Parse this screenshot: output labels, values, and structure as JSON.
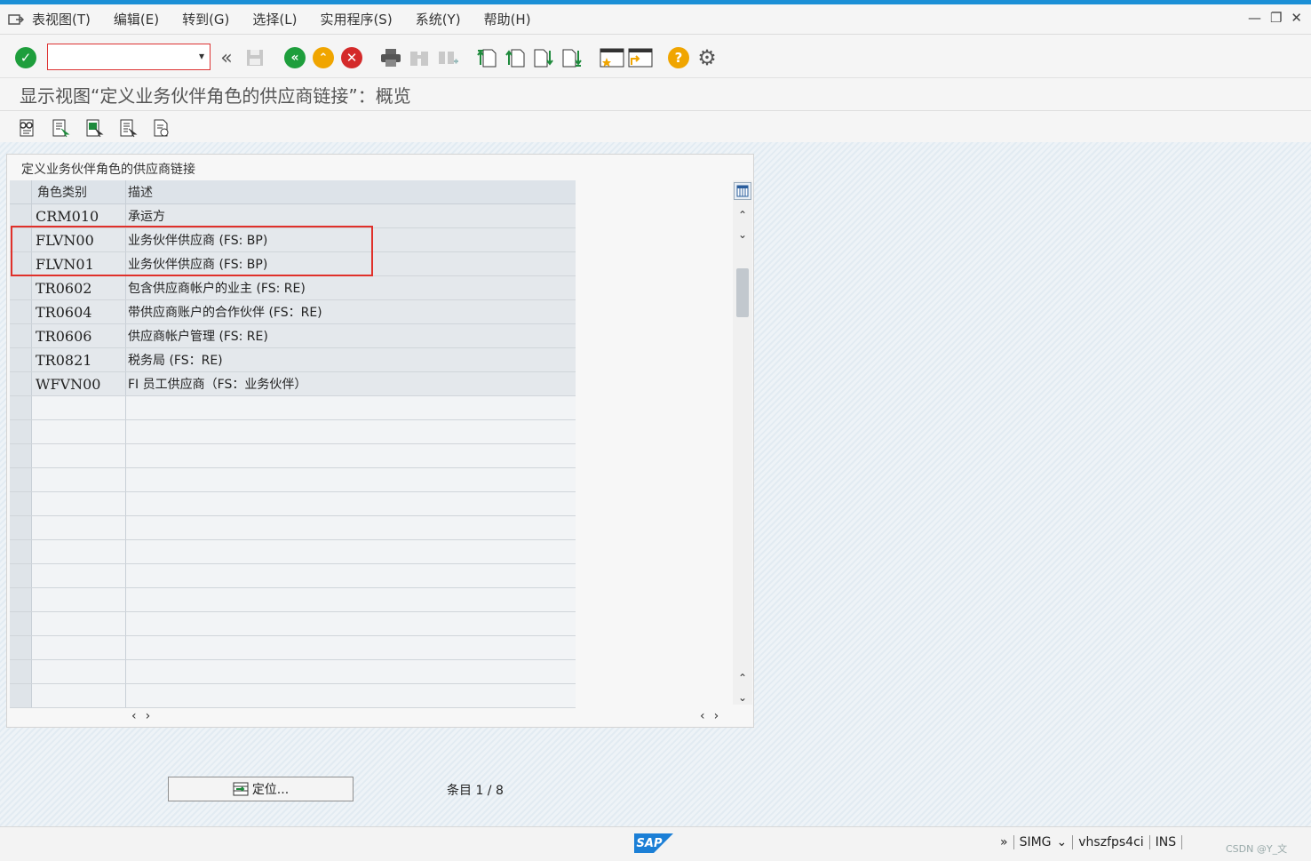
{
  "menubar": {
    "items": [
      {
        "label": "表视图(T)"
      },
      {
        "label": "编辑(E)"
      },
      {
        "label": "转到(G)"
      },
      {
        "label": "选择(L)"
      },
      {
        "label": "实用程序(S)"
      },
      {
        "label": "系统(Y)"
      },
      {
        "label": "帮助(H)"
      }
    ],
    "window_controls": {
      "minimize": "—",
      "maximize": "❐",
      "close": "✕"
    }
  },
  "toolbar": {
    "command_field_value": "",
    "accent_colors": {
      "green": "#1e9e3c",
      "orange": "#f0a500",
      "red": "#d42a2a",
      "help": "#f0a500"
    }
  },
  "page_title": "显示视图“定义业务伙伴角色的供应商链接”：概览",
  "panel": {
    "title": "定义业务伙伴角色的供应商链接",
    "columns": [
      "角色类别",
      "描述"
    ],
    "rows": [
      {
        "code": "CRM010",
        "desc": "承运方"
      },
      {
        "code": "FLVN00",
        "desc": "业务伙伴供应商 (FS: BP)"
      },
      {
        "code": "FLVN01",
        "desc": "业务伙伴供应商 (FS: BP)"
      },
      {
        "code": "TR0602",
        "desc": "包含供应商帐户的业主 (FS: RE)"
      },
      {
        "code": "TR0604",
        "desc": "带供应商账户的合作伙伴 (FS：RE)"
      },
      {
        "code": "TR0606",
        "desc": "供应商帐户管理 (FS: RE)"
      },
      {
        "code": "TR0821",
        "desc": "税务局 (FS：RE)"
      },
      {
        "code": "WFVN00",
        "desc": "FI 员工供应商（FS：业务伙伴）"
      }
    ],
    "empty_rows": 13
  },
  "footer": {
    "locate_label": "定位...",
    "entry_text": "条目 1 / 8"
  },
  "statusbar": {
    "logo": "SAP",
    "expand": "»",
    "system": "SIMG",
    "server": "vhszfps4ci",
    "mode": "INS",
    "watermark": "CSDN @Y_文"
  }
}
